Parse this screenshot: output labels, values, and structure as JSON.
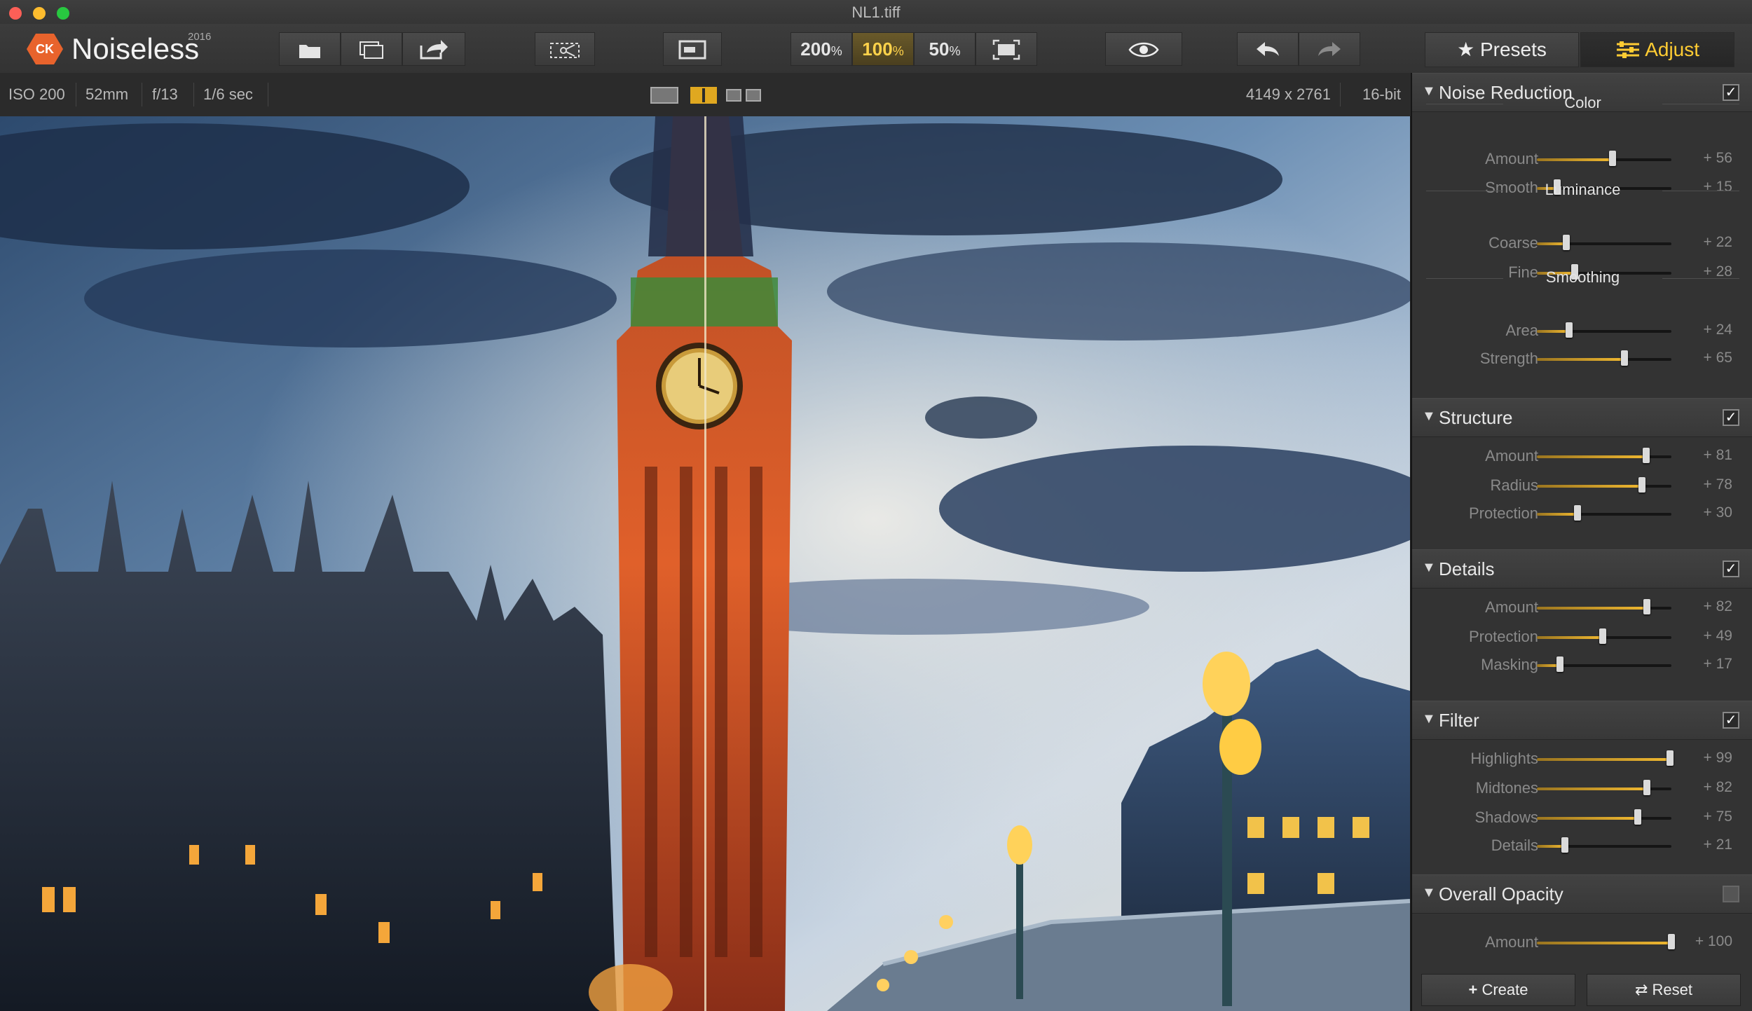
{
  "window": {
    "title": "NL1.tiff"
  },
  "app": {
    "name": "Noiseless",
    "year": "2016",
    "badge": "CK"
  },
  "toolbar": {
    "zoom_levels": [
      {
        "value": "200",
        "unit": "%",
        "active": false
      },
      {
        "value": "100",
        "unit": "%",
        "active": true
      },
      {
        "value": "50",
        "unit": "%",
        "active": false
      }
    ],
    "icons": [
      "open-icon",
      "batch-icon",
      "export-icon",
      "crop-compare-icon",
      "single-view-icon",
      "fit-icon",
      "preview-eye-icon",
      "undo-icon",
      "redo-icon"
    ],
    "presets_label": "Presets",
    "adjust_label": "Adjust"
  },
  "infobar": {
    "iso": "ISO 200",
    "focal": "52mm",
    "aperture": "f/13",
    "shutter": "1/6 sec",
    "dimensions": "4149 x 2761",
    "bitdepth": "16-bit"
  },
  "panel": {
    "sections": [
      {
        "title": "Noise Reduction",
        "checked": true,
        "groups": [
          {
            "title": "Color",
            "rows": [
              {
                "name": "Amount",
                "value": "+ 56"
              },
              {
                "name": "Smooth",
                "value": "+ 15"
              }
            ]
          },
          {
            "title": "Luminance",
            "rows": [
              {
                "name": "Coarse",
                "value": "+ 22"
              },
              {
                "name": "Fine",
                "value": "+ 28"
              }
            ]
          },
          {
            "title": "Smoothing",
            "rows": [
              {
                "name": "Area",
                "value": "+ 24"
              },
              {
                "name": "Strength",
                "value": "+ 65"
              }
            ]
          }
        ]
      },
      {
        "title": "Structure",
        "checked": true,
        "rows": [
          {
            "name": "Amount",
            "value": "+ 81"
          },
          {
            "name": "Radius",
            "value": "+ 78"
          },
          {
            "name": "Protection",
            "value": "+ 30"
          }
        ]
      },
      {
        "title": "Details",
        "checked": true,
        "rows": [
          {
            "name": "Amount",
            "value": "+ 82"
          },
          {
            "name": "Protection",
            "value": "+ 49"
          },
          {
            "name": "Masking",
            "value": "+ 17"
          }
        ]
      },
      {
        "title": "Filter",
        "checked": true,
        "rows": [
          {
            "name": "Highlights",
            "value": "+ 99"
          },
          {
            "name": "Midtones",
            "value": "+ 82"
          },
          {
            "name": "Shadows",
            "value": "+ 75"
          },
          {
            "name": "Details",
            "value": "+ 21"
          }
        ]
      },
      {
        "title": "Overall Opacity",
        "checked": false,
        "rows": [
          {
            "name": "Amount",
            "value": "+ 100"
          }
        ]
      }
    ],
    "create_label": "Create",
    "reset_label": "Reset"
  },
  "colors": {
    "accent": "#f0b830",
    "logo": "#e8632c",
    "panel": "#333333"
  }
}
